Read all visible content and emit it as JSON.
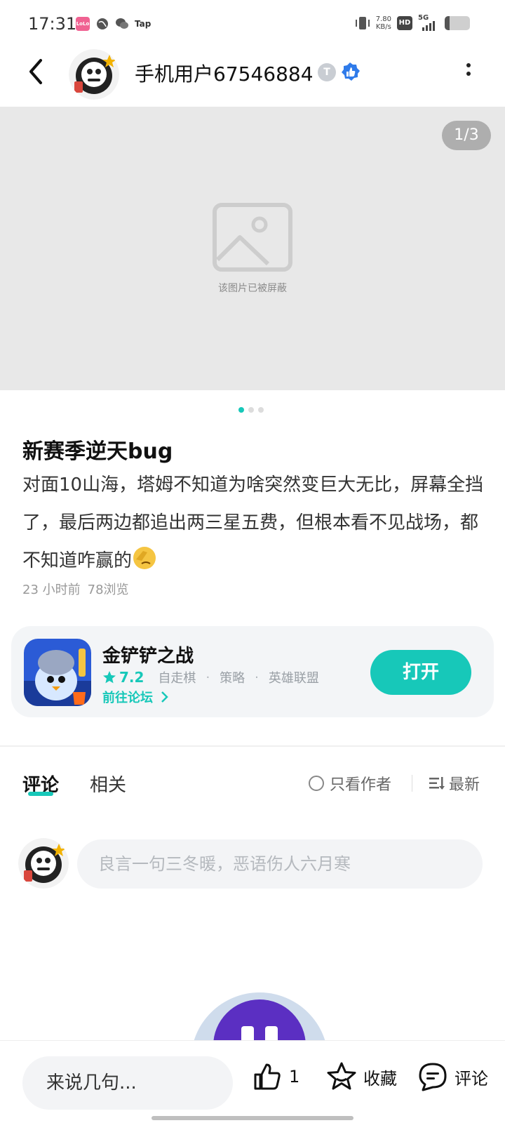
{
  "status_bar": {
    "time": "17:31",
    "app_label": "LoLo",
    "tap_label": "Tap",
    "net_speed_value": "7.80",
    "net_speed_unit": "KB/s",
    "hd_label": "HD",
    "network": "5G",
    "battery_level": 0.2
  },
  "header": {
    "username": "手机用户67546884",
    "level_badge": "T"
  },
  "media": {
    "counter": "1/3",
    "blocked_text": "该图片已被屏蔽",
    "slide_count": 3,
    "active_slide": 1
  },
  "post": {
    "title": "新赛季逆天bug",
    "body": "对面10山海，塔姆不知道为啥突然变巨大无比，屏幕全挡了，最后两边都追出两三星五费，但根本看不见战场，都不知道咋赢的",
    "time_ago": "23 小时前",
    "views": "78浏览"
  },
  "app_card": {
    "name": "金铲铲之战",
    "rating": "7.2",
    "tags": [
      "自走棋",
      "策略",
      "英雄联盟"
    ],
    "forum_link": "前往论坛",
    "open_button": "打开"
  },
  "comments_section": {
    "tabs": [
      {
        "label": "评论"
      },
      {
        "label": "相关"
      }
    ],
    "author_only_label": "只看作者",
    "sort_label": "最新",
    "input_placeholder": "良言一句三冬暖，恶语伤人六月寒"
  },
  "bottom_bar": {
    "input_placeholder": "来说几句...",
    "like_count": "1",
    "favorite_label": "收藏",
    "comment_label": "评论"
  },
  "colors": {
    "accent": "#17c8b9",
    "verified": "#2f7bea",
    "float_purple": "#5b2fc2"
  },
  "icons": [
    "back-arrow-icon",
    "more-icon",
    "verified-icon",
    "image-placeholder-icon",
    "star-icon",
    "chevron-right-icon",
    "sort-icon",
    "like-icon",
    "favorite-icon",
    "comment-icon"
  ]
}
